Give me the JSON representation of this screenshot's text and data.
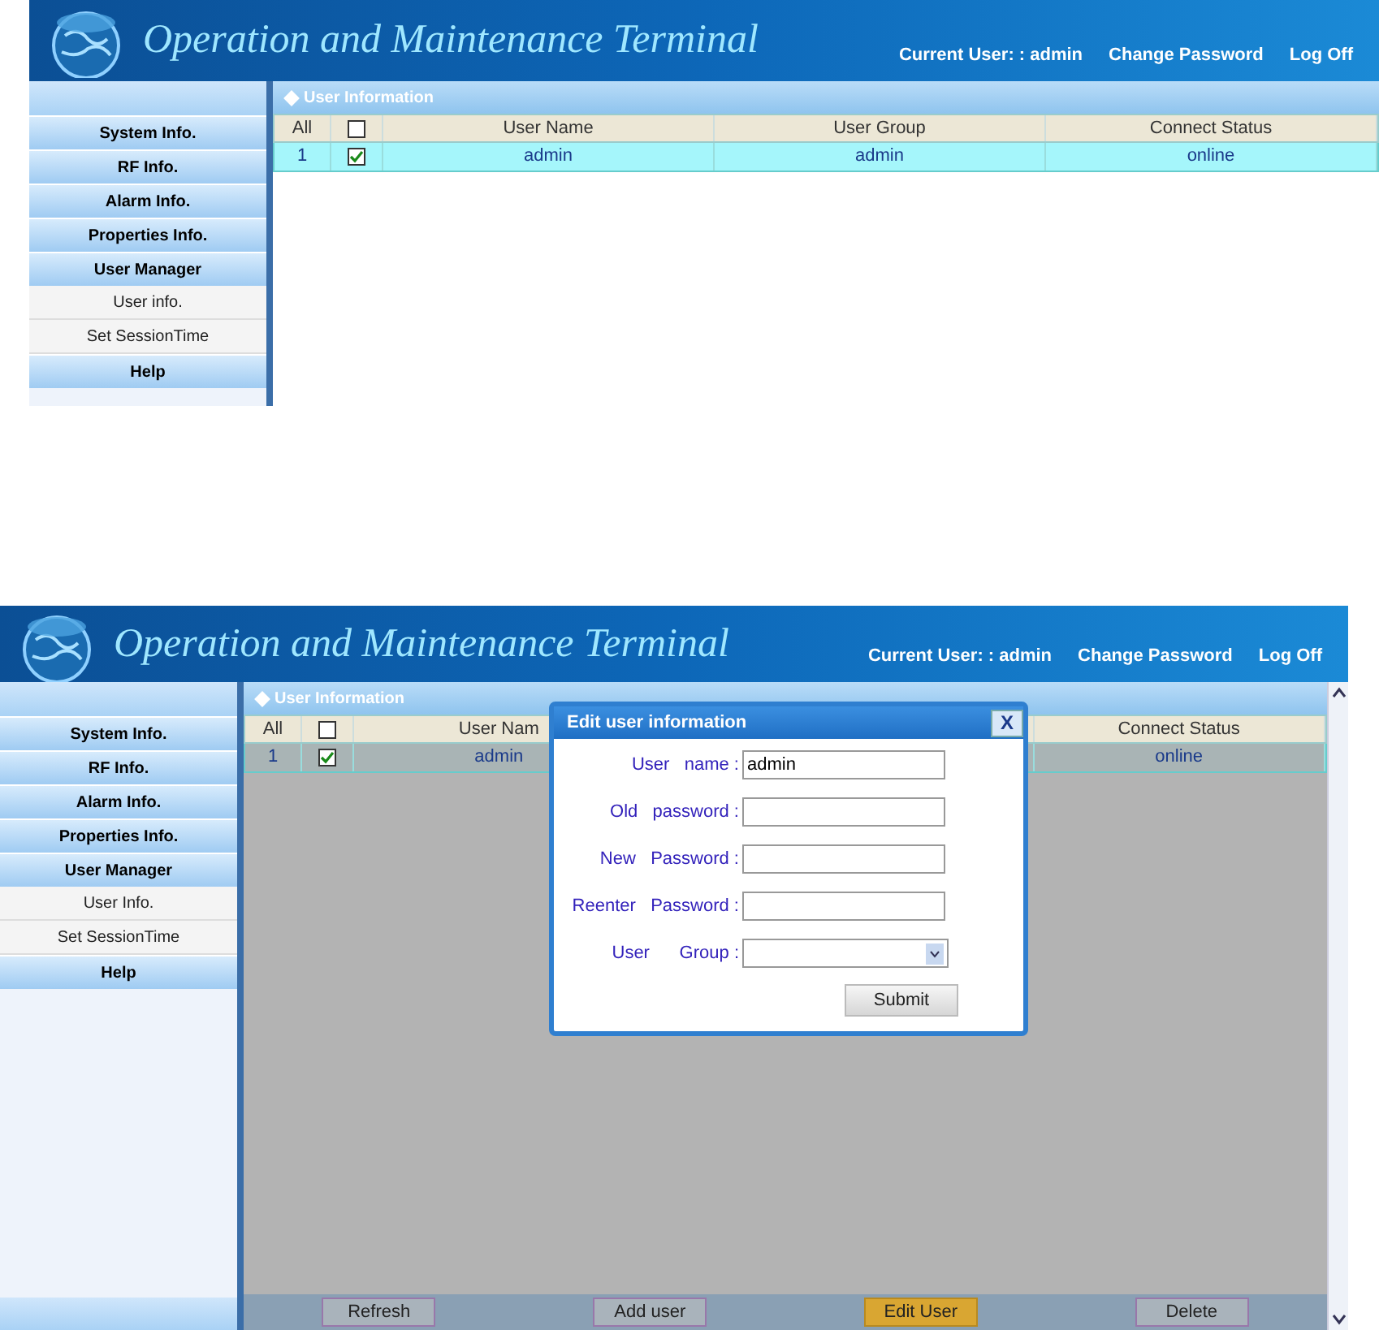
{
  "screenshots": [
    {
      "header": {
        "title": "Operation and Maintenance Terminal",
        "current_user": "Current User: : admin",
        "links": [
          "Change Password",
          "Log Off"
        ]
      },
      "sidebar": {
        "items": [
          {
            "label": "System Info.",
            "kind": "section"
          },
          {
            "label": "RF Info.",
            "kind": "section"
          },
          {
            "label": "Alarm Info.",
            "kind": "section"
          },
          {
            "label": "Properties Info.",
            "kind": "section"
          },
          {
            "label": "User Manager",
            "kind": "section"
          },
          {
            "label": "User info.",
            "kind": "sub"
          },
          {
            "label": "Set SessionTime",
            "kind": "sub"
          },
          {
            "label": "Help",
            "kind": "section"
          }
        ]
      },
      "panel": {
        "title": "User Information"
      },
      "table": {
        "columns": [
          {
            "label": "All",
            "kind": "index"
          },
          {
            "kind": "check",
            "checked": false
          },
          {
            "label": "User Name",
            "kind": "text"
          },
          {
            "label": "User Group",
            "kind": "text"
          },
          {
            "label": "Connect Status",
            "kind": "text"
          }
        ],
        "rows": [
          {
            "cells": [
              {
                "text": "1"
              },
              {
                "checked": true
              },
              {
                "text": "admin"
              },
              {
                "text": "admin"
              },
              {
                "text": "online"
              }
            ]
          }
        ]
      }
    },
    {
      "header": {
        "title": "Operation and Maintenance Terminal",
        "current_user": "Current User: : admin",
        "links": [
          "Change Password",
          "Log Off"
        ]
      },
      "sidebar": {
        "items": [
          {
            "label": "System Info.",
            "kind": "section"
          },
          {
            "label": "RF Info.",
            "kind": "section"
          },
          {
            "label": "Alarm Info.",
            "kind": "section"
          },
          {
            "label": "Properties Info.",
            "kind": "section"
          },
          {
            "label": "User Manager",
            "kind": "section"
          },
          {
            "label": "User Info.",
            "kind": "sub"
          },
          {
            "label": "Set SessionTime",
            "kind": "sub"
          },
          {
            "label": "Help",
            "kind": "section"
          }
        ]
      },
      "panel": {
        "title": "User Information"
      },
      "table": {
        "columns": [
          {
            "label": "All",
            "kind": "index"
          },
          {
            "kind": "check",
            "checked": false
          },
          {
            "label": "User Nam",
            "kind": "text"
          },
          {
            "kind": "text"
          },
          {
            "label": "Connect Status",
            "kind": "text"
          }
        ],
        "rows": [
          {
            "cells": [
              {
                "text": "1"
              },
              {
                "checked": true
              },
              {
                "text": "admin"
              },
              {},
              {
                "text": "online"
              }
            ]
          }
        ]
      },
      "dialog": {
        "title": "Edit user information",
        "close": "X",
        "fields": [
          {
            "label": "User   name :",
            "kind": "text",
            "value": "admin"
          },
          {
            "label": "Old   password :",
            "kind": "text"
          },
          {
            "label": "New   Password :",
            "kind": "text"
          },
          {
            "label": "Reenter   Password :",
            "kind": "text"
          },
          {
            "label": "User      Group :",
            "kind": "select"
          }
        ],
        "submit": "Submit"
      },
      "buttons": [
        {
          "label": "Refresh",
          "selected": false
        },
        {
          "label": "Add user",
          "selected": false
        },
        {
          "label": "Edit User",
          "selected": true
        },
        {
          "label": "Delete",
          "selected": false
        }
      ]
    }
  ]
}
